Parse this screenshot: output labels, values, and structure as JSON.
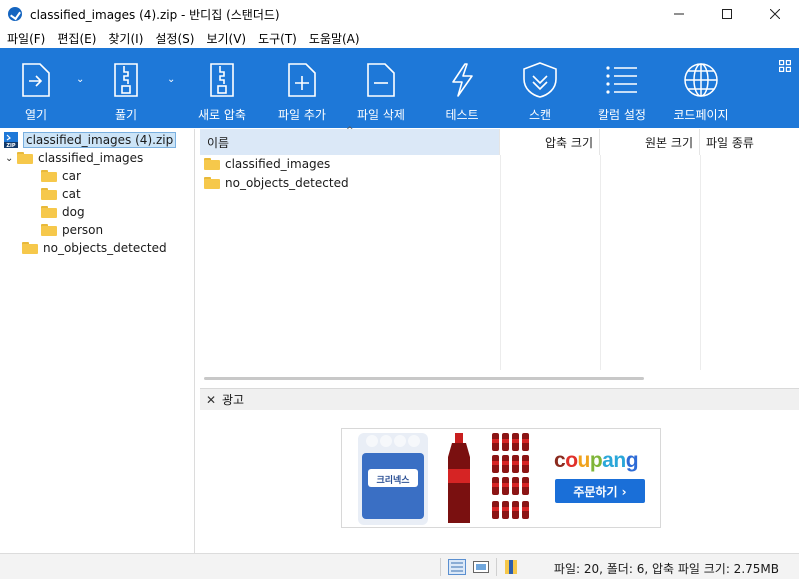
{
  "window": {
    "title": "classified_images (4).zip - 반디집 (스탠더드)",
    "controls": [
      "minimize",
      "maximize",
      "close"
    ]
  },
  "menu": [
    "파일(F)",
    "편집(E)",
    "찾기(I)",
    "설정(S)",
    "보기(V)",
    "도구(T)",
    "도움말(A)"
  ],
  "toolbar": {
    "open": "열기",
    "extract": "풀기",
    "new_archive": "새로 압축",
    "add_files": "파일 추가",
    "delete_files": "파일 삭제",
    "test": "테스트",
    "scan": "스캔",
    "column_settings": "칼럼 설정",
    "codepage": "코드페이지",
    "accent": "#1e78d8"
  },
  "tree": {
    "root": "classified_images (4).zip",
    "items": [
      {
        "label": "classified_images",
        "level": 1,
        "expanded": true
      },
      {
        "label": "car",
        "level": 2
      },
      {
        "label": "cat",
        "level": 2
      },
      {
        "label": "dog",
        "level": 2
      },
      {
        "label": "person",
        "level": 2
      },
      {
        "label": "no_objects_detected",
        "level": 1
      }
    ]
  },
  "list": {
    "columns": {
      "name": "이름",
      "compressed_size": "압축 크기",
      "original_size": "원본 크기",
      "type": "파일 종류"
    },
    "rows": [
      {
        "name": "classified_images",
        "icon": "folder-icon"
      },
      {
        "name": "no_objects_detected",
        "icon": "folder-icon"
      }
    ]
  },
  "ad": {
    "title": "광고",
    "brand": "coupang",
    "cta": "주문하기 ›",
    "product_text": "크리넥스"
  },
  "status": {
    "text": "파일: 20, 폴더: 6, 압축 파일 크기: 2.75MB"
  }
}
